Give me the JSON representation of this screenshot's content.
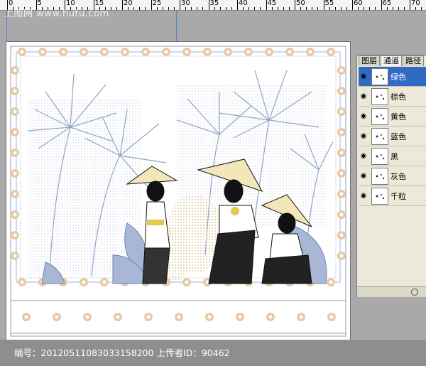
{
  "watermark_top": "上图网 www.hutu.com",
  "ruler": {
    "numbers": [
      "0",
      "5",
      "10",
      "15",
      "20",
      "25",
      "30",
      "35",
      "40",
      "45",
      "50",
      "55",
      "60",
      "65",
      "70"
    ]
  },
  "panel": {
    "tabs": [
      "图层",
      "通道",
      "路径"
    ],
    "active_tab": 1,
    "channels": [
      {
        "label": "绿色",
        "selected": true
      },
      {
        "label": "棕色",
        "selected": false
      },
      {
        "label": "黄色",
        "selected": false
      },
      {
        "label": "蓝色",
        "selected": false
      },
      {
        "label": "黑",
        "selected": false
      },
      {
        "label": "灰色",
        "selected": false
      },
      {
        "label": "千粒",
        "selected": false
      }
    ]
  },
  "watermark_bottom": "编号：20120511083033158200 上传者ID：90462",
  "colors": {
    "border_orange": "#e8c9a6",
    "border_blue": "#8d9ec2",
    "palm_blue": "#8c9fc4",
    "leaf_yellow": "#d9c48a",
    "ink": "#111111",
    "selected": "#316ac5"
  }
}
